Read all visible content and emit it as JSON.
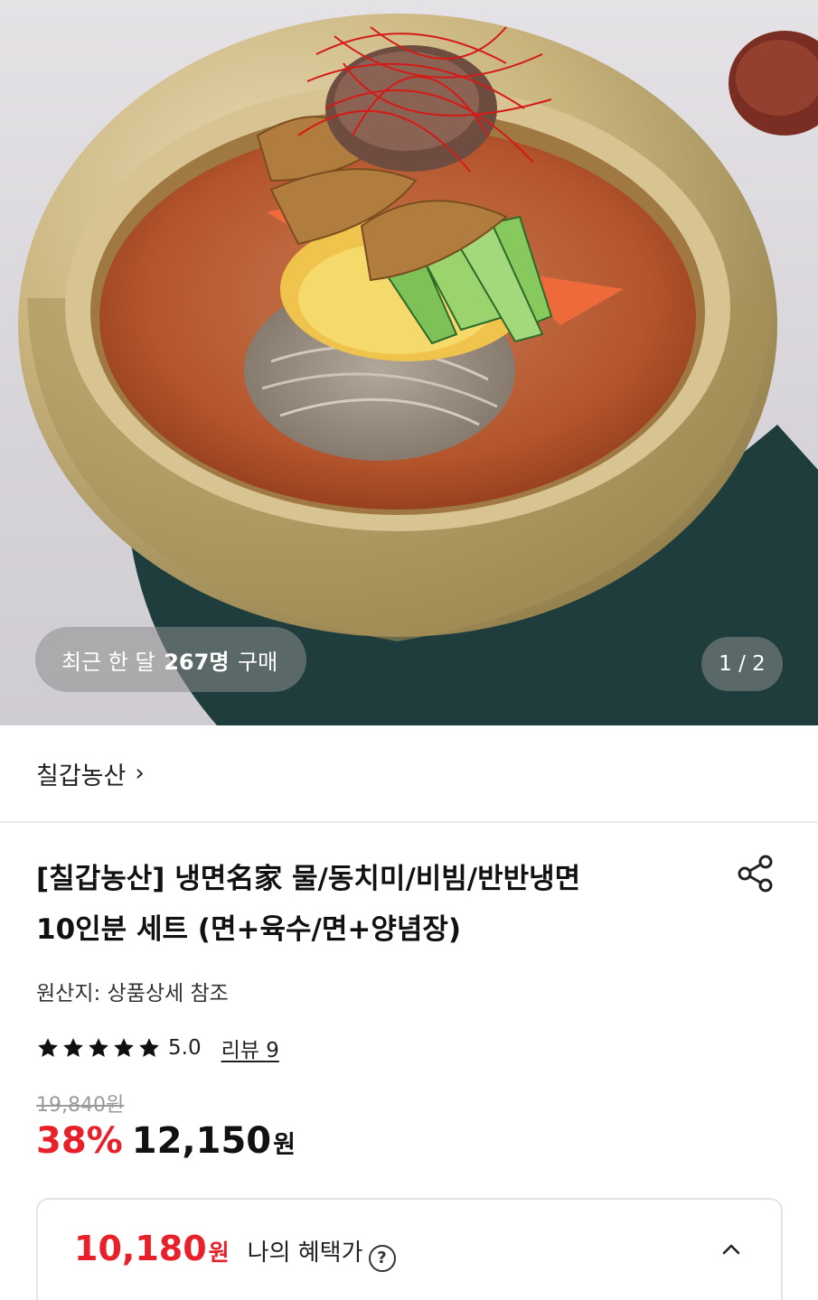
{
  "hero": {
    "image_alt": "냉면 bowl photo",
    "buyers_prefix": "최근 한 달",
    "buyers_count": "267명",
    "buyers_suffix": "구매",
    "page_indicator": "1 / 2"
  },
  "seller": {
    "name": "칠갑농산",
    "chevron": "›"
  },
  "product": {
    "title_line1": "[칠갑농산] 냉면名家 물/동치미/비빔/반반냉면",
    "title_line2": "10인분 세트 (면+육수/면+양념장)",
    "origin": "원산지: 상품상세 참조",
    "rating": "5.0",
    "rating_fraction": 1.0,
    "review_link": "리뷰 9",
    "original_price": "19,840원",
    "discount": "38%",
    "price": "12,150",
    "price_unit": "원"
  },
  "benefit": {
    "price": "10,180",
    "price_unit": "원",
    "label": "나의 혜택가",
    "help_glyph": "?"
  },
  "colors": {
    "accent_red": "#e8202a",
    "text": "#111111",
    "muted": "#9a9a9a",
    "divider": "#ececec"
  },
  "icons": [
    "star-icon",
    "share-icon",
    "chevron-right-icon",
    "chevron-up-icon",
    "help-icon"
  ]
}
